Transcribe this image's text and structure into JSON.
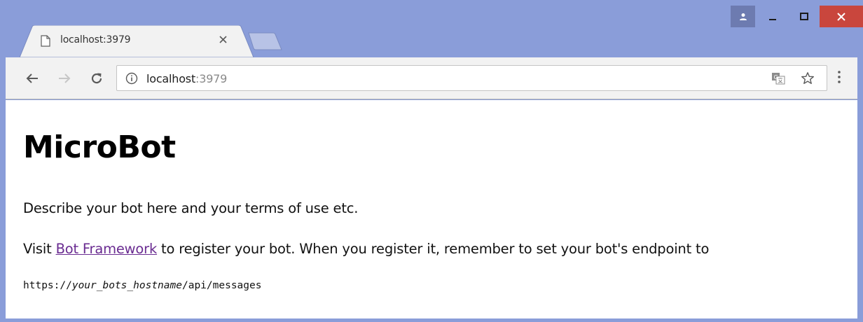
{
  "browser": {
    "tab": {
      "title": "localhost:3979",
      "favicon": "page-icon",
      "close": "close-icon"
    },
    "address_bar": {
      "host": "localhost",
      "port": ":3979"
    },
    "colors": {
      "frame": "#8a9dd9",
      "close_button": "#c9463d",
      "toolbar": "#f2f2f2",
      "link": "#6a2c91"
    },
    "icons": {
      "profile": "person-icon",
      "minimize": "minimize-icon",
      "maximize": "maximize-icon",
      "close_window": "close-icon",
      "back": "arrow-left-icon",
      "forward": "arrow-right-icon",
      "reload": "reload-icon",
      "site_info": "info-icon",
      "translate": "translate-icon",
      "bookmark": "star-icon",
      "menu": "more-vert-icon"
    }
  },
  "page": {
    "title": "MicroBot",
    "description": "Describe your bot here and your terms of use etc.",
    "register": {
      "prefix": "Visit ",
      "link_text": "Bot Framework",
      "suffix": " to register your bot. When you register it, remember to set your bot's endpoint to"
    },
    "endpoint": {
      "prefix": "https://",
      "placeholder": "your_bots_hostname",
      "suffix": "/api/messages"
    }
  }
}
